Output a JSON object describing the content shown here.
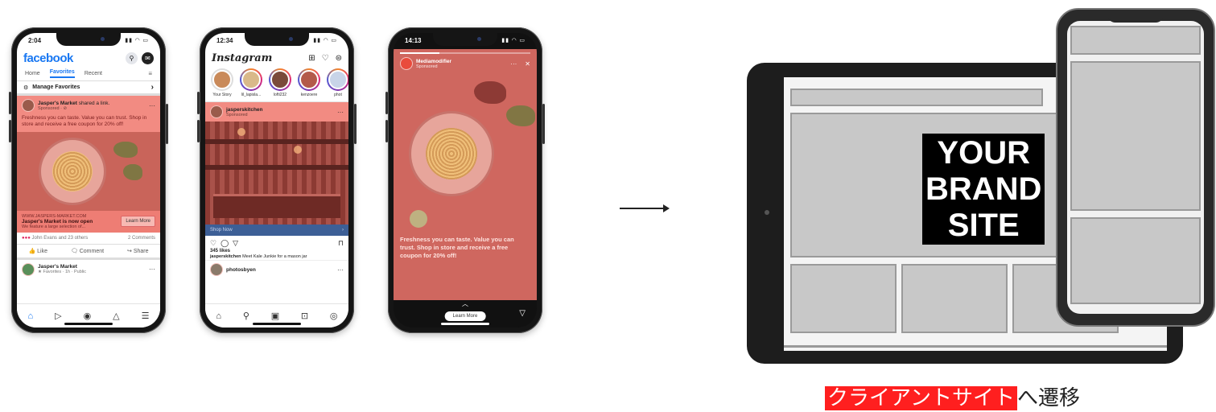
{
  "facebook": {
    "time": "2:04",
    "logo": "facebook",
    "tabs": [
      "Home",
      "Favorites",
      "Recent"
    ],
    "manage": "Manage Favorites",
    "post": {
      "name": "Jasper's Market",
      "action": " shared a link.",
      "sub": "Sponsored · ⊘",
      "text": "Freshness you can taste. Value you can trust. Shop in store and receive a free coupon for 20% off!",
      "link_url": "WWW.JASPERS-MARKET.COM",
      "link_title": "Jasper's Market is now open",
      "link_desc": "We feature a large selection of...",
      "cta": "Learn More",
      "reactions": "John Evans and 23 others",
      "comments": "2 Comments",
      "like": "Like",
      "comment": "Comment",
      "share": "Share"
    },
    "next": {
      "name": "Jasper's Market",
      "sub": "★ Favorites · 1h · Public"
    }
  },
  "instagram": {
    "time": "12:34",
    "logo": "Instagram",
    "stories": [
      "Your Story",
      "lil_lapisla...",
      "lofti232",
      "kenzoere",
      "phot"
    ],
    "post": {
      "name": "jasperskitchen",
      "sub": "Sponsored",
      "shop": "Shop Now",
      "likes": "345 likes",
      "caption_user": "jasperskitchen",
      "caption": "Meet Kale Junkie for a mason jar"
    },
    "next": "photosbyen"
  },
  "story": {
    "time": "14:13",
    "name": "Mediamodifier",
    "sub": "Sponsored",
    "text": "Freshness you can taste. Value you can trust. Shop in store and receive a free coupon for 20% off!",
    "cta": "Learn More"
  },
  "site": {
    "brand_lines": [
      "YOUR",
      "BRAND",
      "SITE"
    ]
  },
  "caption": {
    "highlight": "クライアントサイト",
    "rest": "へ遷移",
    "highlight_color": "#ff1f1f"
  }
}
